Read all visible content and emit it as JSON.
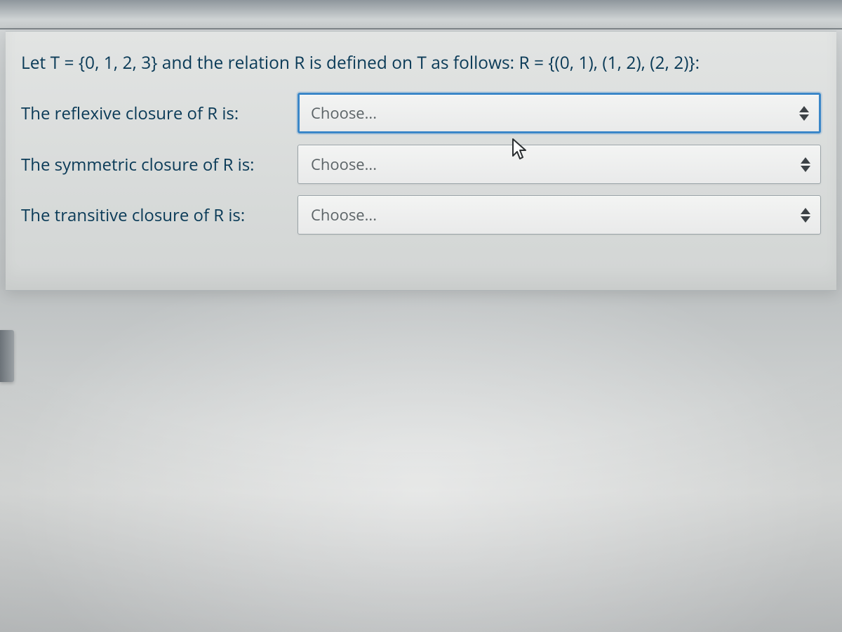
{
  "prompt": "Let T = {0, 1, 2, 3} and  the relation R is defined on T as follows: R = {(0, 1), (1, 2), (2, 2)}:",
  "rows": [
    {
      "label": "The reflexive closure of R is:",
      "placeholder": "Choose...",
      "focused": true
    },
    {
      "label": "The symmetric closure of R is:",
      "placeholder": "Choose...",
      "focused": false
    },
    {
      "label": "The transitive closure of R is:",
      "placeholder": "Choose...",
      "focused": false
    }
  ],
  "icons": {
    "spinner": "sort-spinner-icon",
    "cursor": "mouse-cursor-icon"
  }
}
